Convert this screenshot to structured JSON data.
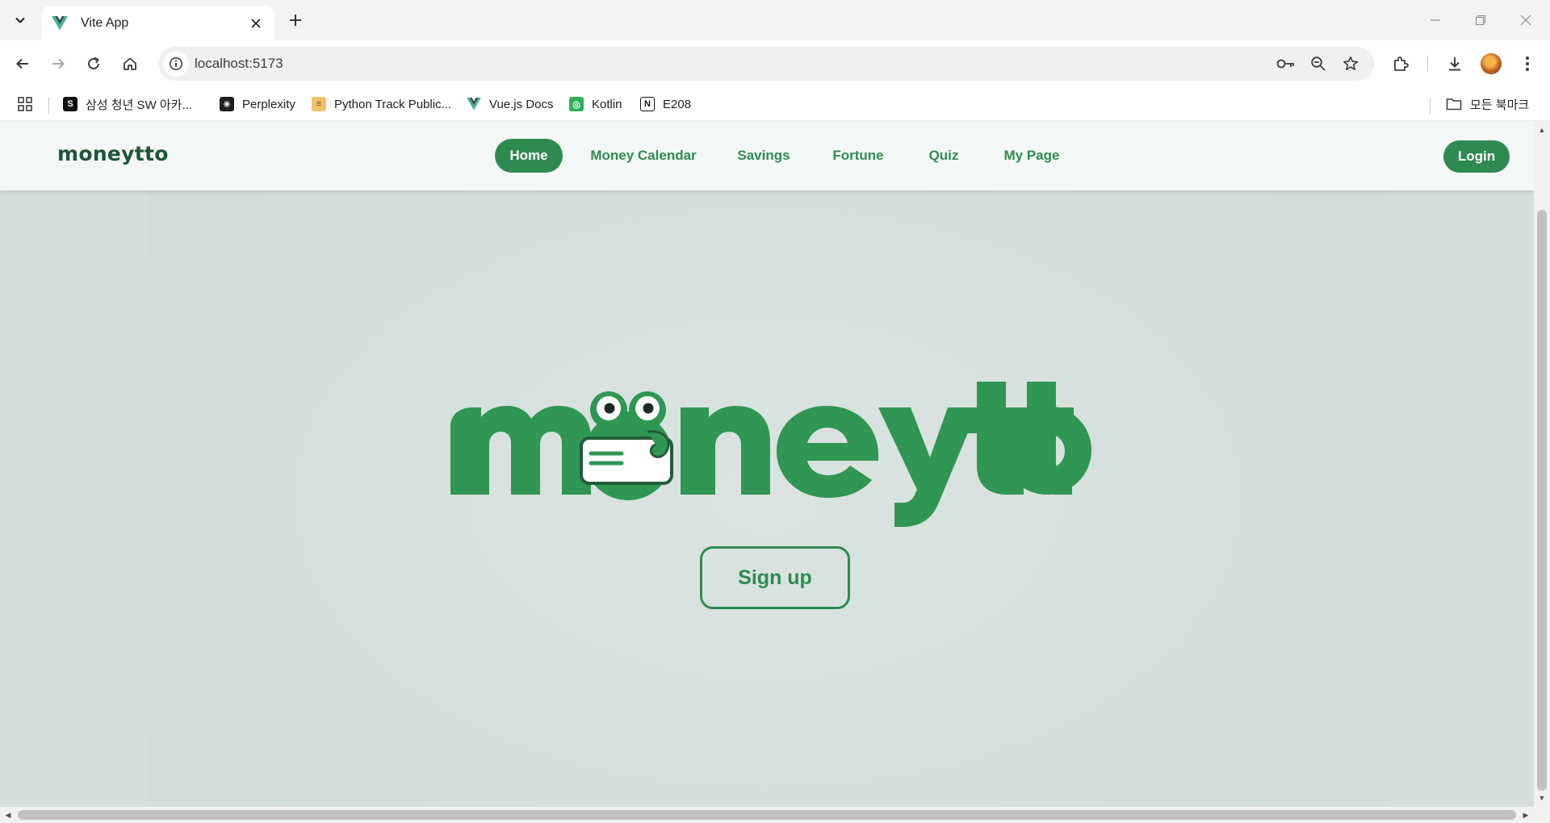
{
  "browser": {
    "tab_title": "Vite App",
    "url": "localhost:5173",
    "bookmarks": [
      {
        "label": "삼성 청년 SW 아카..."
      },
      {
        "label": "Perplexity"
      },
      {
        "label": "Python Track Public..."
      },
      {
        "label": "Vue.js Docs"
      },
      {
        "label": "Kotlin"
      },
      {
        "label": "E208"
      }
    ],
    "all_bookmarks_label": "모든 북마크"
  },
  "site": {
    "brand": "moneytto",
    "nav": [
      {
        "label": "Home",
        "active": true
      },
      {
        "label": "Money Calendar",
        "active": false
      },
      {
        "label": "Savings",
        "active": false
      },
      {
        "label": "Fortune",
        "active": false
      },
      {
        "label": "Quiz",
        "active": false
      },
      {
        "label": "My Page",
        "active": false
      }
    ],
    "login_label": "Login",
    "hero_logo_text": "moneytto",
    "signup_label": "Sign up"
  },
  "colors": {
    "brand_green": "#2f8a52",
    "brand_dark": "#1f5537",
    "page_bg": "#d4dfdb"
  }
}
